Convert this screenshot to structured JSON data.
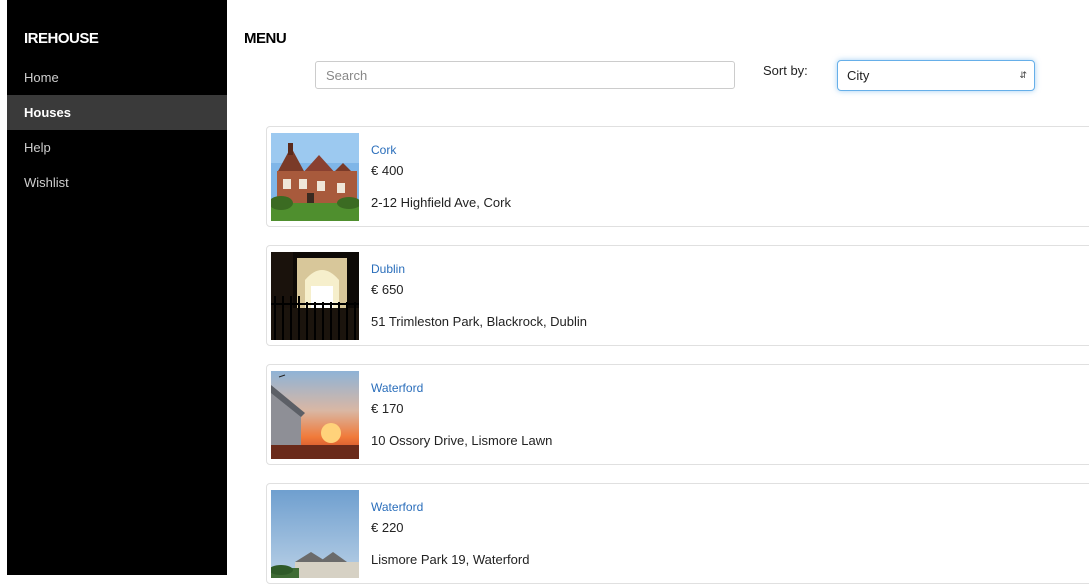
{
  "sidebar": {
    "brand": "IREHOUSE",
    "items": [
      {
        "label": "Home",
        "active": false
      },
      {
        "label": "Houses",
        "active": true
      },
      {
        "label": "Help",
        "active": false
      },
      {
        "label": "Wishlist",
        "active": false
      }
    ]
  },
  "header": {
    "title": "MENU",
    "search_placeholder": "Search",
    "sort_label": "Sort by:",
    "sort_value": "City"
  },
  "listings": [
    {
      "city": "Cork",
      "price": "€ 400",
      "address": "2-12 Highfield Ave, Cork",
      "image": "brick-house-photo"
    },
    {
      "city": "Dublin",
      "price": "€ 650",
      "address": "51 Trimleston Park, Blackrock, Dublin",
      "image": "night-house-photo"
    },
    {
      "city": "Waterford",
      "price": "€ 170",
      "address": "10 Ossory Drive, Lismore Lawn",
      "image": "sunset-house-photo"
    },
    {
      "city": "Waterford",
      "price": "€ 220",
      "address": "Lismore Park 19, Waterford",
      "image": "terrace-houses-photo"
    }
  ],
  "colors": {
    "sidebar_bg": "#000000",
    "active_item_bg": "#3a3a3a",
    "link": "#2a6ebb",
    "focus_border": "#66afe9"
  }
}
